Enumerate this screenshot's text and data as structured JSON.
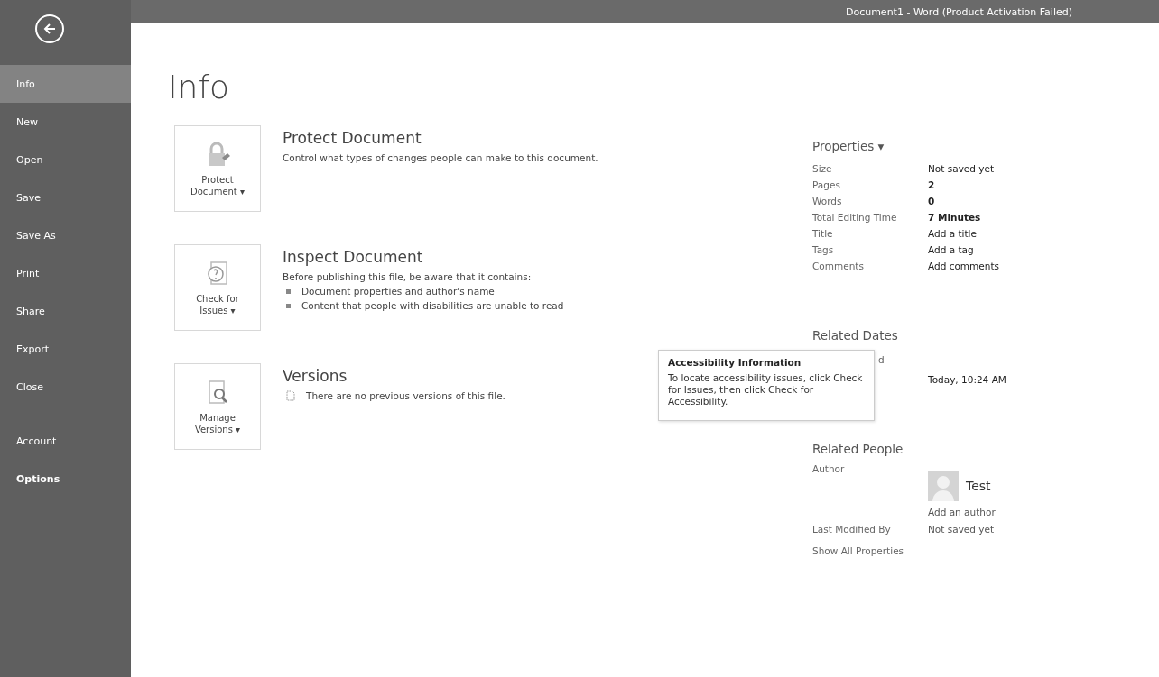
{
  "window": {
    "title": "Document1 -  Word (Product Activation Failed)"
  },
  "sidebar": {
    "items": [
      {
        "label": "Info",
        "selected": true,
        "bold": false
      },
      {
        "label": "New",
        "selected": false,
        "bold": false
      },
      {
        "label": "Open",
        "selected": false,
        "bold": false
      },
      {
        "label": "Save",
        "selected": false,
        "bold": false
      },
      {
        "label": "Save As",
        "selected": false,
        "bold": false
      },
      {
        "label": "Print",
        "selected": false,
        "bold": false
      },
      {
        "label": "Share",
        "selected": false,
        "bold": false
      },
      {
        "label": "Export",
        "selected": false,
        "bold": false
      },
      {
        "label": "Close",
        "selected": false,
        "bold": false
      }
    ],
    "bottom_items": [
      {
        "label": "Account",
        "selected": false,
        "bold": false
      },
      {
        "label": "Options",
        "selected": false,
        "bold": true
      }
    ]
  },
  "page_title": "Info",
  "sections": [
    {
      "kind": "protect",
      "button": [
        "Protect",
        "Document ▾"
      ],
      "heading": "Protect Document",
      "text": "Control what types of changes people can make to this document."
    },
    {
      "kind": "inspect",
      "button": [
        "Check for",
        "Issues ▾"
      ],
      "heading": "Inspect Document",
      "text": "Before publishing this file, be aware that it contains:",
      "bullets": [
        "Document properties and author's name",
        "Content that people with disabilities are unable to read"
      ]
    },
    {
      "kind": "versions",
      "button": [
        "Manage",
        "Versions ▾"
      ],
      "heading": "Versions",
      "note": "There are no previous versions of this file."
    }
  ],
  "properties": {
    "heading": "Properties ▾",
    "rows": [
      {
        "label": "Size",
        "value": "Not saved yet",
        "bold": false
      },
      {
        "label": "Pages",
        "value": "2",
        "bold": true
      },
      {
        "label": "Words",
        "value": "0",
        "bold": true
      },
      {
        "label": "Total Editing Time",
        "value": "7 Minutes",
        "bold": true
      },
      {
        "label": "Title",
        "value": "Add a title",
        "bold": false
      },
      {
        "label": "Tags",
        "value": "Add a tag",
        "bold": false
      },
      {
        "label": "Comments",
        "value": "Add comments",
        "bold": false
      }
    ]
  },
  "related_dates": {
    "heading": "Related Dates",
    "rows": [
      {
        "kind": "partial",
        "label": "d"
      },
      {
        "kind": "value",
        "value": "Today, 10:24 AM"
      }
    ]
  },
  "related_people": {
    "heading": "Related People",
    "author_label": "Author",
    "author_name": "Test",
    "add_author": "Add an author",
    "modified_label": "Last Modified By",
    "modified_value": "Not saved yet",
    "show_all": "Show All Properties"
  },
  "tooltip": {
    "title": "Accessibility Information",
    "text": "To locate accessibility issues, click Check for Issues, then click Check for Accessibility."
  }
}
